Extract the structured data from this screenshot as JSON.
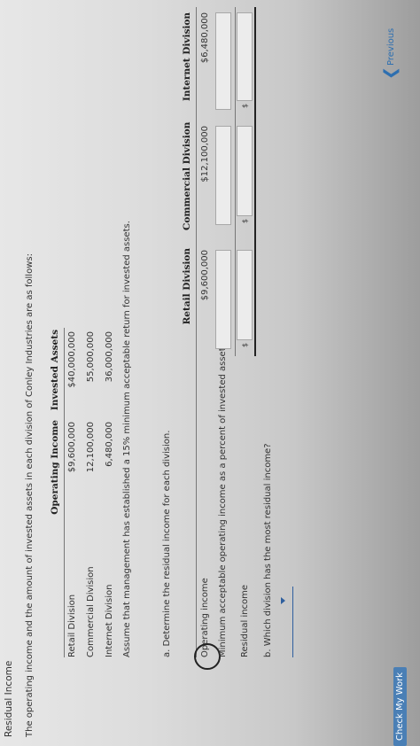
{
  "header": {
    "title": "Residual Income",
    "intro": "The operating income and the amount of invested assets in each division of Conley Industries are as follows:"
  },
  "data_table": {
    "headers": [
      "Operating Income",
      "Invested Assets"
    ],
    "rows": [
      {
        "label": "Retail Division",
        "income": "$9,600,000",
        "assets": "$40,000,000"
      },
      {
        "label": "Commercial Division",
        "income": "12,100,000",
        "assets": "55,000,000"
      },
      {
        "label": "Internet Division",
        "income": "6,480,000",
        "assets": "36,000,000"
      }
    ]
  },
  "assumption": "Assume that management has established a 15% minimum acceptable return for invested assets.",
  "part_a": {
    "prompt": "a.  Determine the residual income for each division.",
    "columns": [
      "Retail Division",
      "Commercial Division",
      "Internet Division"
    ],
    "rows": {
      "operating_income": {
        "label": "Operating income",
        "values": [
          "$9,600,000",
          "$12,100,000",
          "$6,480,000"
        ]
      },
      "minimum_income": {
        "label": "Minimum acceptable operating income as a percent of invested assets"
      },
      "residual_income": {
        "label": "Residual income",
        "dollar": "$"
      }
    }
  },
  "part_b": {
    "prompt": "b.  Which division has the most residual income?"
  },
  "footer": {
    "previous_label": "Previous",
    "previous_chevron": "❮",
    "check_label": "Check My Work"
  },
  "icons": [
    "chevron-left-icon",
    "dropdown-caret-icon"
  ],
  "colors": {
    "link": "#2e6fb0",
    "dropdown": "#2e5f9e"
  }
}
